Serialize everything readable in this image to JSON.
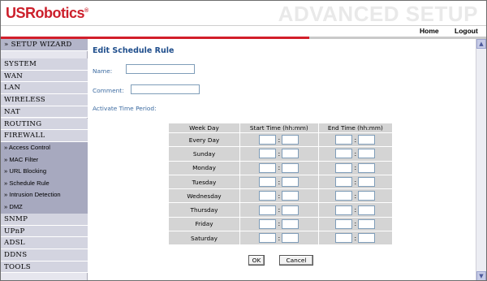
{
  "header": {
    "logo_text": "USRobotics",
    "logo_mark": "®",
    "section_title": "ADVANCED SETUP",
    "nav": {
      "home": "Home",
      "logout": "Logout"
    }
  },
  "sidebar": {
    "wizard": "» SETUP WIZARD",
    "items_top": [
      "SYSTEM",
      "WAN",
      "LAN",
      "WIRELESS",
      "NAT",
      "ROUTING",
      "FIREWALL"
    ],
    "sub_items": [
      "» Access Control",
      "» MAC Filter",
      "» URL Blocking",
      "» Schedule Rule",
      "» Intrusion Detection",
      "» DMZ"
    ],
    "items_bottom": [
      "SNMP",
      "UPnP",
      "ADSL",
      "DDNS",
      "TOOLS"
    ]
  },
  "content": {
    "title": "Edit Schedule Rule",
    "name_label": "Name:",
    "name_value": "",
    "comment_label": "Comment:",
    "comment_value": "",
    "period_label": "Activate Time Period:",
    "table": {
      "headers": [
        "Week Day",
        "Start Time (hh:mm)",
        "End Time (hh:mm)"
      ],
      "days": [
        "Every Day",
        "Sunday",
        "Monday",
        "Tuesday",
        "Wednesday",
        "Thursday",
        "Friday",
        "Saturday"
      ],
      "colon": ":"
    },
    "buttons": {
      "ok": "OK",
      "cancel": "Cancel"
    }
  },
  "colors": {
    "brand_red": "#cc1f2b",
    "title_blue": "#1f4e8c",
    "label_blue": "#3b6aa0",
    "sidebar_bg": "#d3d4e0",
    "subgroup_bg": "#a7a9bf"
  },
  "icons": {
    "scroll_up": "scroll-up-arrow-icon",
    "scroll_down": "scroll-down-arrow-icon"
  }
}
